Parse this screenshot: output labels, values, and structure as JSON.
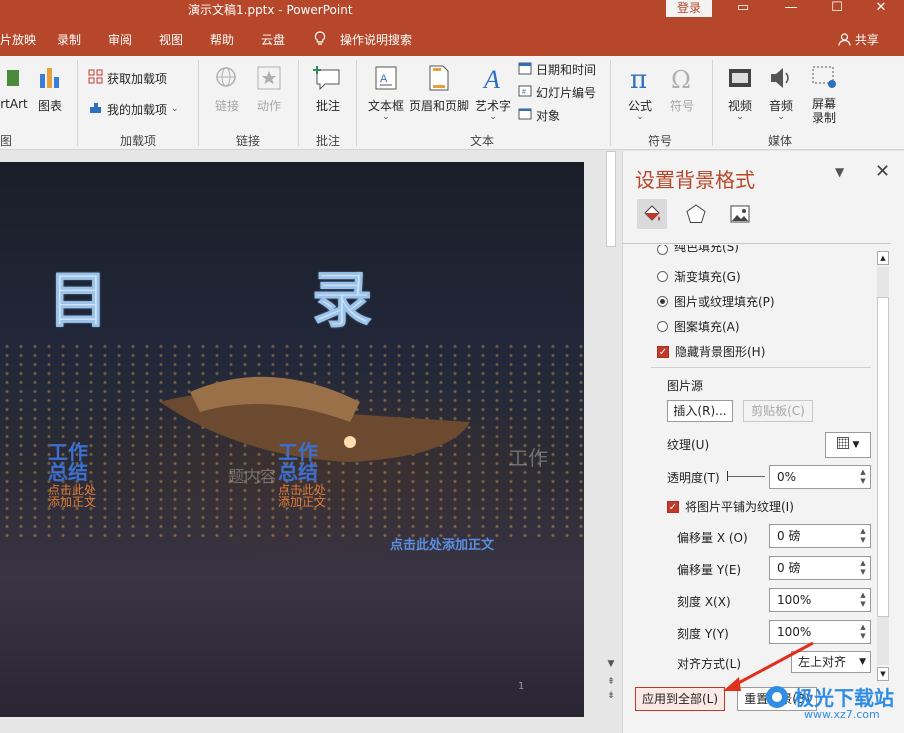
{
  "window": {
    "title": "演示文稿1.pptx  -  PowerPoint",
    "login": "登录",
    "controls": [
      "▭",
      "—",
      "☐",
      "✕"
    ]
  },
  "menu": {
    "tabs": [
      "片放映",
      "录制",
      "审阅",
      "视图",
      "帮助",
      "云盘",
      "操作说明搜索"
    ],
    "share": "共享"
  },
  "ribbon": {
    "smartart": "rtArt",
    "chart": "图表",
    "group_illus": "图",
    "get_addins": "获取加载项",
    "my_addins": "我的加载项",
    "group_addins": "加载项",
    "link": "链接",
    "action": "动作",
    "group_links": "链接",
    "comment": "批注",
    "group_comments": "批注",
    "textbox": "文本框",
    "header_footer": "页眉和页脚",
    "wordart": "艺术字",
    "date_time": "日期和时间",
    "slide_number": "幻灯片编号",
    "object": "对象",
    "group_text": "文本",
    "equation": "公式",
    "symbol": "符号",
    "group_symbols": "符号",
    "video": "视频",
    "audio": "音频",
    "screen_record": "屏幕录制",
    "group_media": "媒体"
  },
  "slide": {
    "title_left": "目",
    "title_right": "录",
    "sec1_title": "工作总结",
    "sec1_sub1": "点击此处",
    "sec1_sub2": "添加正文",
    "sec2_title": "工作总结",
    "sec2_sub1": "点击此处",
    "sec2_sub2": "添加正文",
    "ghost_text": "题内容",
    "ghost_right": "工作",
    "body_text": "点击此处添加正文",
    "page_number": "1"
  },
  "pane": {
    "title": "设置背景格式",
    "options": [
      {
        "label": "纯色填充(S)",
        "selected": false
      },
      {
        "label": "渐变填充(G)",
        "selected": false
      },
      {
        "label": "图片或纹理填充(P)",
        "selected": true
      },
      {
        "label": "图案填充(A)",
        "selected": false
      }
    ],
    "hide_bg": "隐藏背景图形(H)",
    "picture_source": "图片源",
    "insert": "插入(R)...",
    "clipboard": "剪贴板(C)",
    "texture": "纹理(U)",
    "transparency": "透明度(T)",
    "transparency_value": "0%",
    "tile": "将图片平铺为纹理(I)",
    "offset_x": "偏移量 X (O)",
    "offset_x_value": "0 磅",
    "offset_y": "偏移量 Y(E)",
    "offset_y_value": "0 磅",
    "scale_x": "刻度 X(X)",
    "scale_x_value": "100%",
    "scale_y": "刻度 Y(Y)",
    "scale_y_value": "100%",
    "alignment": "对齐方式(L)",
    "alignment_value": "左上对齐",
    "apply_all": "应用到全部(L)",
    "reset": "重置背景(B)"
  },
  "watermark": "极光下载站",
  "watermark_url": "www.xz7.com"
}
